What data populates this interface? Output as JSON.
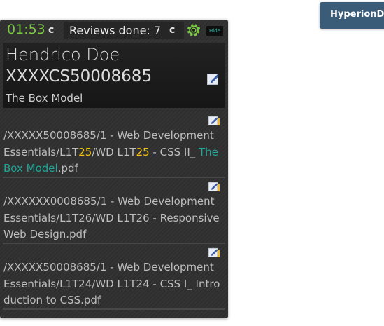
{
  "topbar": {
    "timer": "01:53",
    "refresh_glyph": "c",
    "reviews_label": "Reviews done: 7",
    "hide_label": "Hide",
    "colors": {
      "timer": "#7ac943",
      "gear": "#7ac943",
      "hide_text": "#2bb5a0"
    },
    "icons": [
      "refresh-icon",
      "gear-icon"
    ]
  },
  "student": {
    "name": "Hendrico Doe",
    "id": "XXXXCS50008685",
    "task": "The Box Model"
  },
  "files": [
    {
      "path_prefix": "/XXXXX50008685/1 - Web Development Essentials/L1T",
      "num1": "25",
      "mid": "/WD L1T",
      "num2": "25",
      "title_prefix": " - CSS II_ ",
      "title_highlight": "The Box Model",
      "ext": ".pdf"
    },
    {
      "text": "/XXXXXX0008685/1 - Web Development Essentials/L1T26/WD L1T26 - Responsive Web Design.pdf"
    },
    {
      "text": "/XXXXX50008685/1 - Web Development Essentials/L1T24/WD L1T24 - CSS I_ Introduction to CSS.pdf"
    }
  ],
  "brand": {
    "label": "HyperionD",
    "color": "#3b5c78"
  },
  "accent_colors": {
    "highlight_number": "#f4c20d",
    "highlight_title": "#22a699"
  }
}
